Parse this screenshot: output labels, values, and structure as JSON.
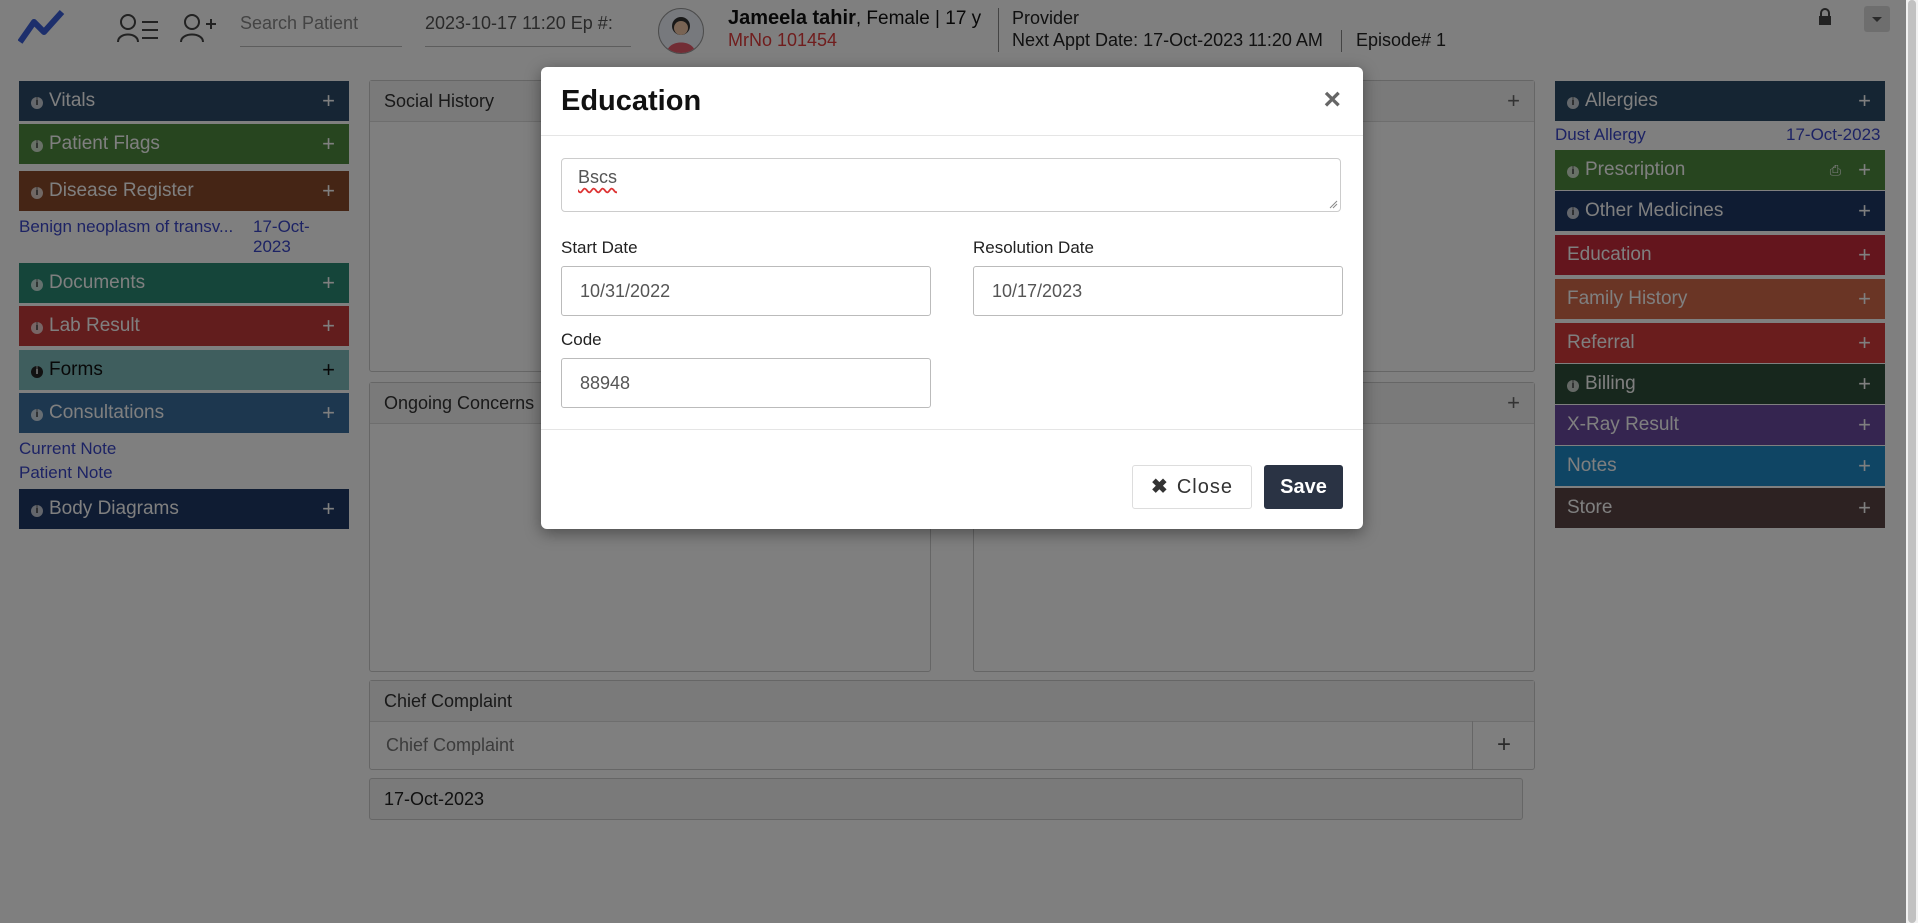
{
  "header": {
    "search_placeholder": "Search Patient",
    "episode_field": "2023-10-17 11:20 Ep #:",
    "patient_name": "Jameela tahir",
    "patient_meta": ", Female | 17 y",
    "mrno": "MrNo 101454",
    "provider_label": "Provider",
    "next_appt": "Next Appt Date: 17-Oct-2023 11:20 AM",
    "episode_no": "Episode# 1"
  },
  "left_panels": {
    "vitals": "Vitals",
    "patient_flags": "Patient Flags",
    "disease_register": "Disease Register",
    "disease_item": "Benign neoplasm of transv...",
    "disease_date_1": "17-Oct-",
    "disease_date_2": "2023",
    "documents": "Documents",
    "lab_result": "Lab Result",
    "forms": "Forms",
    "consultations": "Consultations",
    "current_note": "Current Note",
    "patient_note": "Patient Note",
    "body_diagrams": "Body Diagrams"
  },
  "center": {
    "social_history": "Social History",
    "ongoing_concerns": "Ongoing Concerns",
    "chief_complaint": "Chief Complaint",
    "chief_complaint_placeholder": "Chief Complaint",
    "date_row": "17-Oct-2023"
  },
  "right_panels": {
    "allergies": "Allergies",
    "allergy_item": "Dust Allergy",
    "allergy_date": "17-Oct-2023",
    "prescription": "Prescription",
    "other_medicines": "Other Medicines",
    "education": "Education",
    "family_history": "Family History",
    "referral": "Referral",
    "billing": "Billing",
    "xray": "X-Ray Result",
    "notes": "Notes",
    "store": "Store"
  },
  "modal": {
    "title": "Education",
    "close_icon": "×",
    "education_text": "Bscs",
    "start_date_label": "Start Date",
    "start_date_value": "10/31/2022",
    "resolution_date_label": "Resolution Date",
    "resolution_date_value": "10/17/2023",
    "code_label": "Code",
    "code_value": "88948",
    "close_button": "Close",
    "save_button": "Save"
  },
  "colors": {
    "vitals": "#2c4a68",
    "patient_flags": "#4f8a3f",
    "disease_register": "#8a4a2a",
    "documents": "#2a8a74",
    "lab_result": "#c43a3a",
    "forms": "#7fbcbc",
    "consultations": "#3a6e9e",
    "body_diagrams": "#1f3866",
    "allergies": "#2b4a66",
    "prescription": "#4f8a3f",
    "other_medicines": "#1f3866",
    "education": "#c82a3a",
    "family_history": "#d46a4a",
    "referral": "#d43a3a",
    "billing": "#2f4f3a",
    "xray": "#6a4aa0",
    "notes": "#1f8ac8",
    "store": "#5a4444"
  }
}
